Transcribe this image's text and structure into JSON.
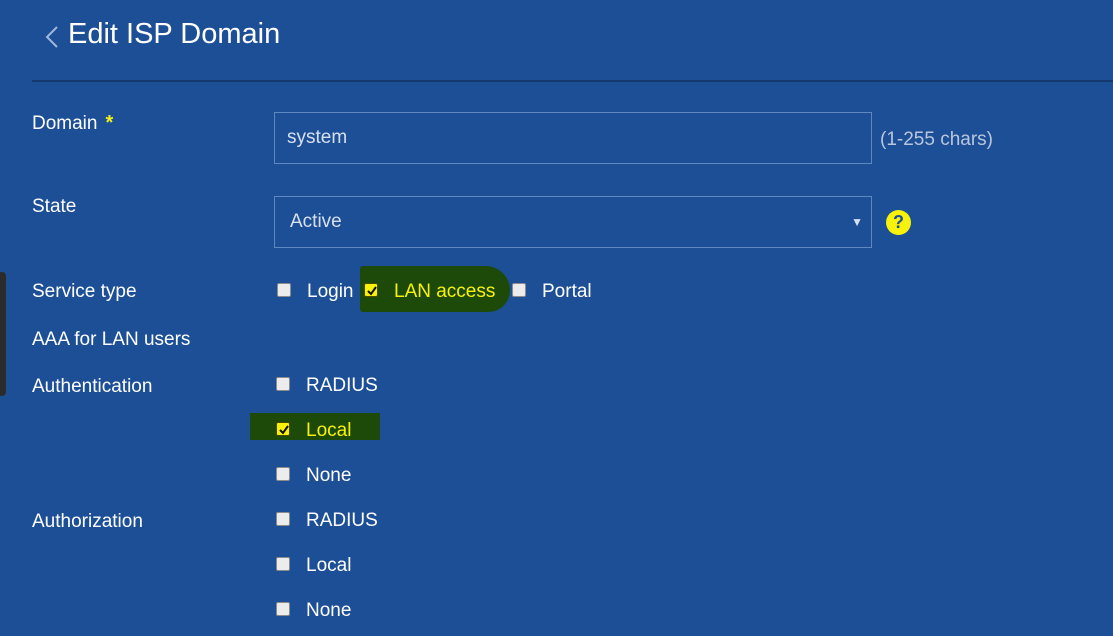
{
  "header": {
    "title": "Edit ISP Domain",
    "back_icon": "chevron-left-icon"
  },
  "domain": {
    "label": "Domain",
    "required_mark": "*",
    "value": "system",
    "hint": "(1-255 chars)"
  },
  "state": {
    "label": "State",
    "selected": "Active",
    "help_glyph": "?"
  },
  "service_type": {
    "label": "Service type",
    "options": [
      {
        "label": "Login",
        "checked": false
      },
      {
        "label": "LAN access",
        "checked": true
      },
      {
        "label": "Portal",
        "checked": false
      }
    ]
  },
  "aaa_section": {
    "label": "AAA for LAN users"
  },
  "authentication": {
    "label": "Authentication",
    "options": [
      {
        "label": "RADIUS",
        "checked": false
      },
      {
        "label": "Local",
        "checked": true
      },
      {
        "label": "None",
        "checked": false
      }
    ]
  },
  "authorization": {
    "label": "Authorization",
    "options": [
      {
        "label": "RADIUS",
        "checked": false
      },
      {
        "label": "Local",
        "checked": false
      },
      {
        "label": "None",
        "checked": false
      }
    ]
  },
  "colors": {
    "background": "#1d4f97",
    "highlight_background": "#1d4a08",
    "highlight_text": "#f8f20a",
    "required_star": "#f5ef16"
  }
}
